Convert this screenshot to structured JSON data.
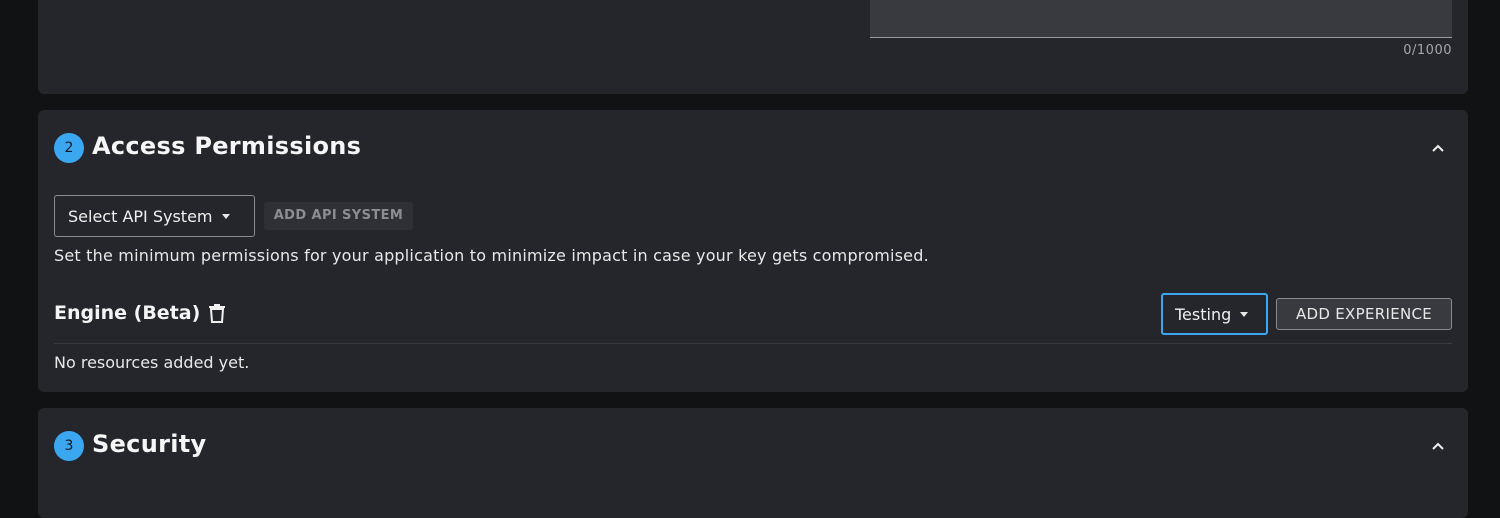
{
  "description_field": {
    "char_count": "0/1000"
  },
  "access_section": {
    "step": "2",
    "title": "Access Permissions",
    "select_api_label": "Select API System",
    "add_api_label": "ADD API SYSTEM",
    "help_text": "Set the minimum permissions for your application to minimize impact in case your key gets compromised.",
    "engine": {
      "title": "Engine (Beta)",
      "experience_select": "Testing",
      "add_experience_label": "ADD EXPERIENCE",
      "empty_text": "No resources added yet."
    }
  },
  "security_section": {
    "step": "3",
    "title": "Security"
  },
  "colors": {
    "accent": "#3aa7f0",
    "card_bg": "#25262b",
    "page_bg": "#111214"
  },
  "icons": [
    "chevron-up-icon",
    "trash-icon",
    "caret-down-icon"
  ]
}
